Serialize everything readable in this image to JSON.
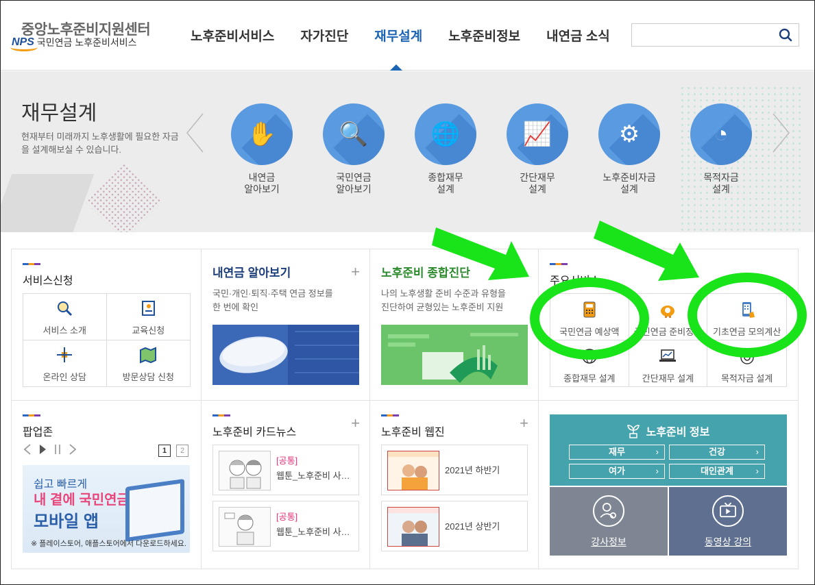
{
  "header": {
    "org_name": "중앙노후준비지원센터",
    "nps_mark": "NPS",
    "org_sub": "국민연금 노후준비서비스",
    "nav": [
      {
        "label": "노후준비서비스",
        "active": false
      },
      {
        "label": "자가진단",
        "active": false
      },
      {
        "label": "재무설계",
        "active": true
      },
      {
        "label": "노후준비정보",
        "active": false
      },
      {
        "label": "내연금 소식",
        "active": false
      }
    ],
    "search_placeholder": ""
  },
  "banner": {
    "title": "재무설계",
    "description": "현재부터 미래까지 노후생활에 필요한 자금을 설계해보실 수 있습니다.",
    "items": [
      {
        "line1": "내연금",
        "line2": "알아보기",
        "icon": "hand-coins-icon",
        "glyph": "✋"
      },
      {
        "line1": "국민연금",
        "line2": "알아보기",
        "icon": "nps-document-icon",
        "glyph": "🔍"
      },
      {
        "line1": "종합재무",
        "line2": "설계",
        "icon": "globe-chart-icon",
        "glyph": "🌐"
      },
      {
        "line1": "간단재무",
        "line2": "설계",
        "icon": "magnifier-chart-icon",
        "glyph": "📈"
      },
      {
        "line1": "노후준비자금",
        "line2": "설계",
        "icon": "gear-person-icon",
        "glyph": "⚙"
      },
      {
        "line1": "목적자금",
        "line2": "설계",
        "icon": "pie-coin-icon",
        "glyph": "◔"
      }
    ]
  },
  "service": {
    "title": "서비스신청",
    "items": [
      {
        "label": "서비스 소개",
        "icon": "magnifier-icon"
      },
      {
        "label": "교육신청",
        "icon": "contact-list-icon"
      },
      {
        "label": "온라인 상담",
        "icon": "network-icon"
      },
      {
        "label": "방문상담 신청",
        "icon": "map-icon"
      }
    ]
  },
  "mypension": {
    "title": "내연금 알아보기",
    "desc_line1": "국민·개인·퇴직·주택 연금 정보를",
    "desc_line2": "한 번에 확인"
  },
  "diagnosis": {
    "title": "노후준비 종합진단",
    "desc_line1": "나의 노후생활 준비 수준과 유형을",
    "desc_line2": "진단하여 균형있는 노후준비 지원"
  },
  "main_services": {
    "title": "주요서비스",
    "items": [
      {
        "label": "국민연금 예상액",
        "icon": "calculator-icon"
      },
      {
        "label": "국민연금 준비정도",
        "icon": "piggy-bank-icon"
      },
      {
        "label": "기초연금 모의계산",
        "icon": "phone-hand-icon"
      },
      {
        "label": "종합재무 설계",
        "icon": "globe-icon"
      },
      {
        "label": "간단재무 설계",
        "icon": "laptop-chart-icon"
      },
      {
        "label": "목적자금 설계",
        "icon": "target-icon"
      }
    ]
  },
  "popup": {
    "title": "팝업존",
    "pages": [
      "1",
      "2"
    ],
    "line1": "쉽고 빠르게",
    "line2": "내 곁에 국민연금",
    "line3": "모바일 앱",
    "line4": "※ 플레이스토어, 애플스토어에서 다운로드하세요."
  },
  "cardnews": {
    "title": "노후준비 카드뉴스",
    "items": [
      {
        "tag": "[공통]",
        "text": "웹툰_노후준비 사…"
      },
      {
        "tag": "[공통]",
        "text": "웹툰_노후준비 사…"
      }
    ]
  },
  "webzine": {
    "title": "노후준비 웹진",
    "items": [
      {
        "text": "2021년 하반기"
      },
      {
        "text": "2021년 상반기"
      }
    ]
  },
  "info": {
    "title": "노후준비 정보",
    "buttons": [
      "재무",
      "건강",
      "여가",
      "대인관계"
    ],
    "lecturer": "강사정보",
    "video": "동영상 강의"
  },
  "colors": {
    "accent": "#1a63b5",
    "annotation": "#19e319",
    "info_teal": "#45a3ad"
  }
}
